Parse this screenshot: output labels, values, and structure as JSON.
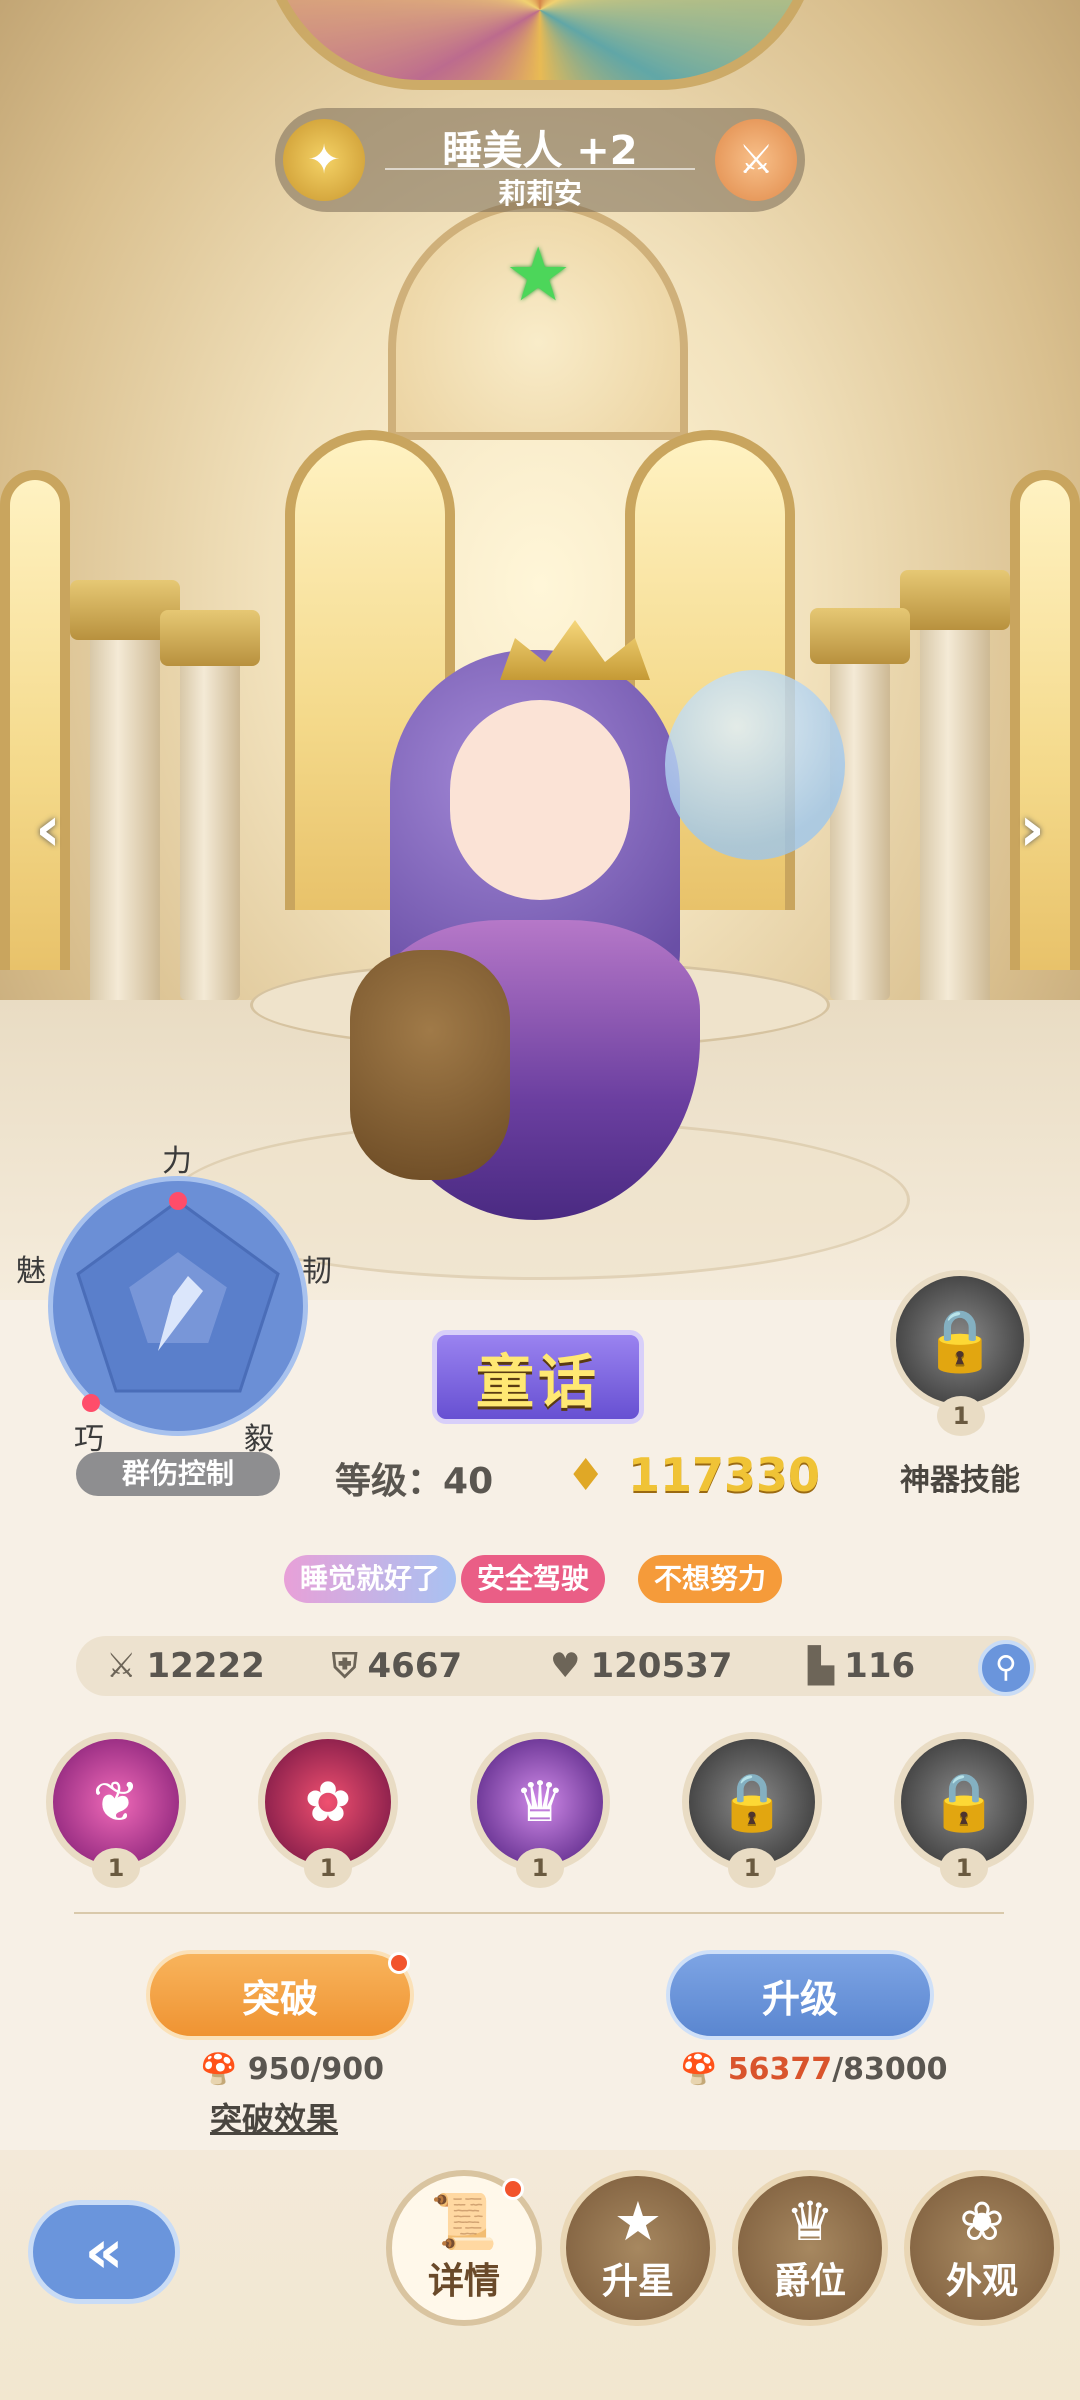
{
  "hero": {
    "name": "睡美人 +2",
    "subtitle": "莉莉安",
    "left_emblem_icon": "wings-emblem-icon",
    "right_emblem_icon": "crossed-swords-icon"
  },
  "radar": {
    "labels": {
      "top": "力",
      "right": "韧",
      "bottom_right": "毅",
      "bottom_left": "巧",
      "left": "魅"
    },
    "role": "群伤控制"
  },
  "faction": "童话",
  "level": {
    "label": "等级：",
    "value": "40"
  },
  "power": "117330",
  "artifact": {
    "label": "神器技能",
    "level": "1"
  },
  "tags": [
    {
      "text": "睡觉就好了",
      "color": "#e39bd6"
    },
    {
      "text": "安全驾驶",
      "color": "#ea5e86"
    },
    {
      "text": "不想努力",
      "color": "#f59b3a"
    }
  ],
  "stats": {
    "attack": "12222",
    "defense": "4667",
    "hp": "120537",
    "speed": "116"
  },
  "skills": [
    {
      "level": "1",
      "icon": "pink-bear-skill-icon",
      "color": "#d03a9a"
    },
    {
      "level": "1",
      "icon": "red-cloud-skill-icon",
      "color": "#c8205a"
    },
    {
      "level": "1",
      "icon": "princess-skill-icon",
      "color": "#a84bc8"
    },
    {
      "level": "1",
      "icon": "locked-skill-icon",
      "color": "#5a5a5a"
    },
    {
      "level": "1",
      "icon": "locked-skill-icon",
      "color": "#5a5a5a"
    }
  ],
  "breakthrough": {
    "label": "突破",
    "cost_have": "950",
    "cost_need": "/900",
    "effect": "突破效果"
  },
  "upgrade": {
    "label": "升级",
    "cost_have": "56377",
    "cost_need": "/83000"
  },
  "tabs": [
    {
      "label": "详情",
      "icon": "scroll-icon",
      "active": true
    },
    {
      "label": "升星",
      "icon": "star-icon",
      "active": false
    },
    {
      "label": "爵位",
      "icon": "crown-icon",
      "active": false
    },
    {
      "label": "外观",
      "icon": "rose-icon",
      "active": false
    }
  ],
  "colors": {
    "accent_blue": "#6a95dc",
    "accent_orange": "#f5a347",
    "gold": "#f0c336"
  }
}
